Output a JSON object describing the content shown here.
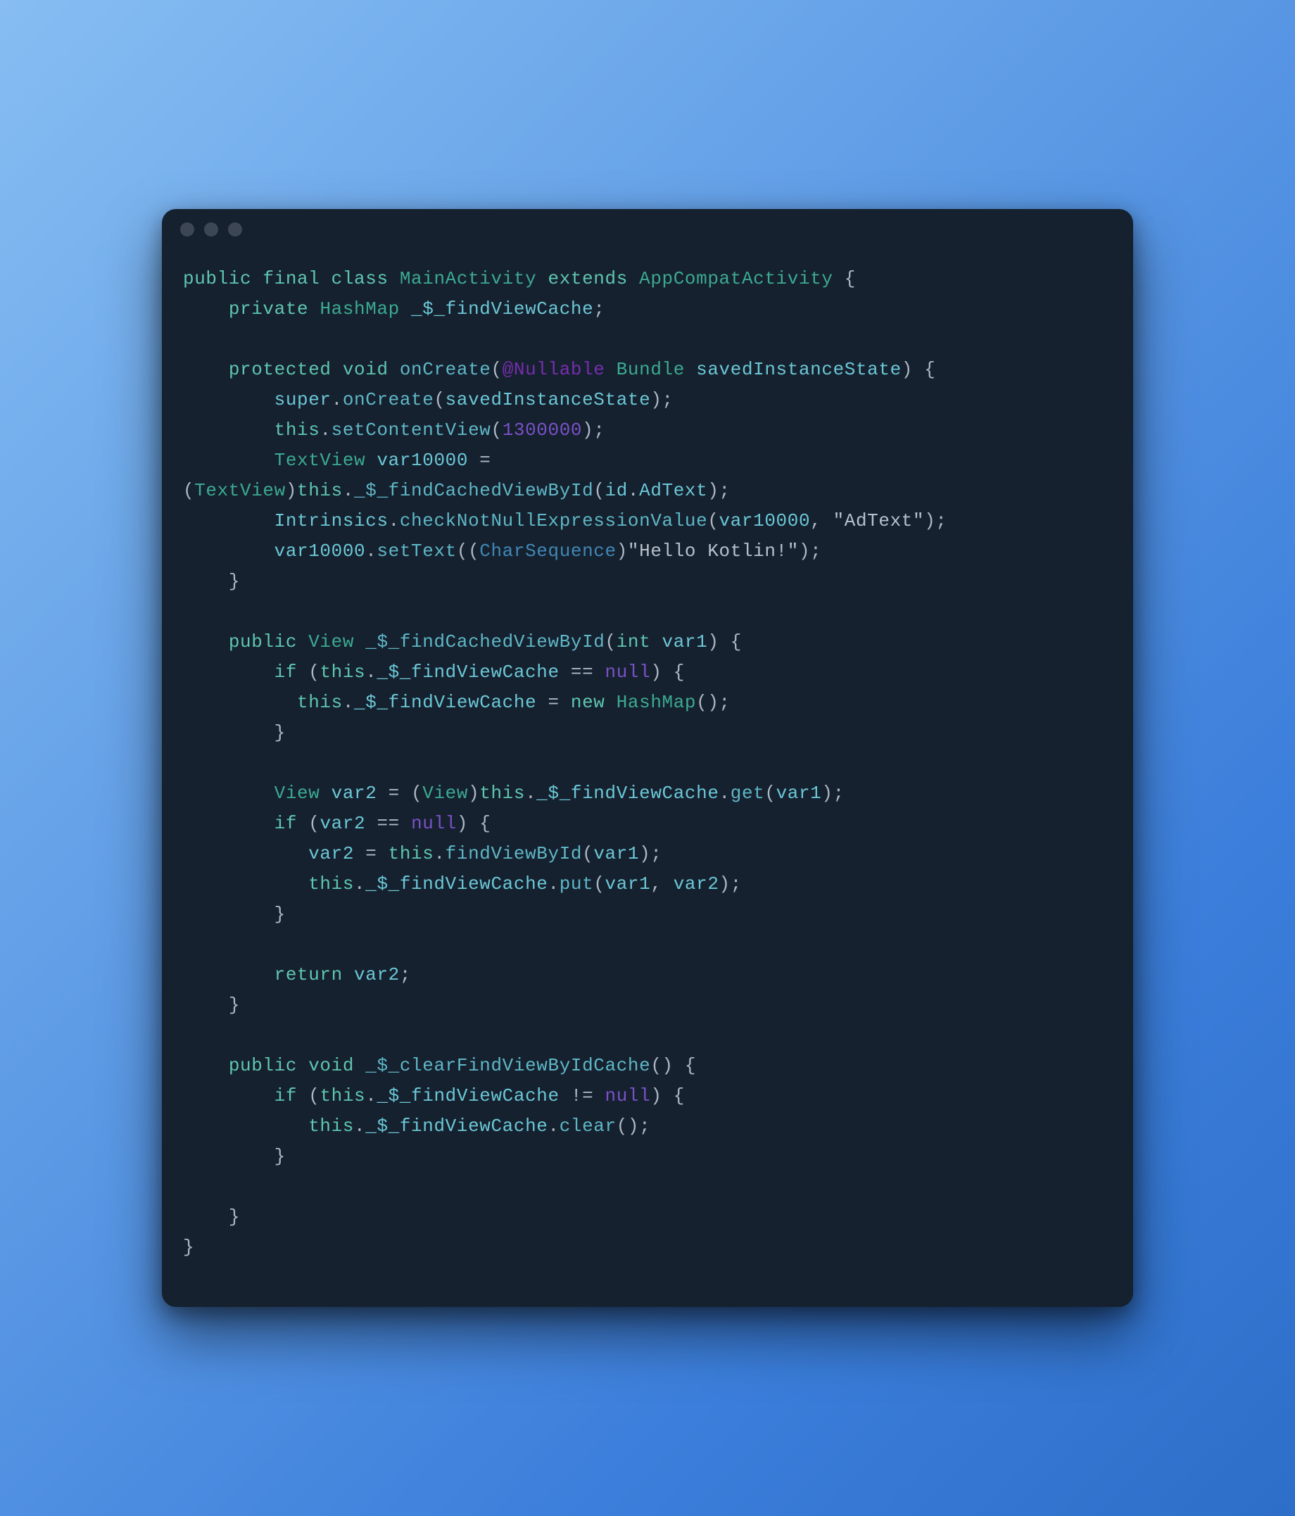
{
  "code": {
    "l1": {
      "kw1": "public",
      "kw2": "final",
      "kw3": "class",
      "typ1": "MainActivity",
      "kw4": "extends",
      "typ2": "AppCompatActivity",
      "ob": "{"
    },
    "l2": {
      "kw1": "private",
      "typ": "HashMap",
      "id": "_$_findViewCache",
      "sc": ";"
    },
    "l3": {
      "kw1": "protected",
      "kw2": "void",
      "m": "onCreate",
      "lp": "(",
      "annot": "@Nullable",
      "typ": "Bundle",
      "id": "savedInstanceState",
      "rp": ")",
      "ob": " {"
    },
    "l4": {
      "id1": "super",
      "dot": ".",
      "m": "onCreate",
      "lp": "(",
      "id2": "savedInstanceState",
      "rp": ")",
      "sc": ";"
    },
    "l5": {
      "kw": "this",
      "dot": ".",
      "m": "setContentView",
      "lp": "(",
      "num": "1300000",
      "rp": ")",
      "sc": ";"
    },
    "l6": {
      "typ": "TextView",
      "id": "var10000",
      "eq": " ="
    },
    "l7": {
      "lp": "(",
      "typ": "TextView",
      "rp": ")",
      "kw": "this",
      "dot": ".",
      "m": "_$_findCachedViewById",
      "lp2": "(",
      "id2": "id",
      "dot2": ".",
      "id3": "AdText",
      "rp2": ")",
      "sc": ";"
    },
    "l8": {
      "id1": "Intrinsics",
      "dot": ".",
      "m": "checkNotNullExpressionValue",
      "lp": "(",
      "id2": "var10000",
      "cm": ", ",
      "str": "\"AdText\"",
      "rp": ")",
      "sc": ";"
    },
    "l9": {
      "id1": "var10000",
      "dot": ".",
      "m": "setText",
      "lp": "(",
      "lp2": "(",
      "typ": "CharSequence",
      "rp2": ")",
      "str": "\"Hello Kotlin!\"",
      "rp": ")",
      "sc": ";"
    },
    "l10": {
      "cb": "}"
    },
    "l12": {
      "kw1": "public",
      "typ": "View",
      "m": "_$_findCachedViewById",
      "lp": "(",
      "kw2": "int",
      "id": "var1",
      "rp": ")",
      "ob": " {"
    },
    "l13": {
      "kw": "if",
      "lp": " (",
      "kw2": "this",
      "dot": ".",
      "id": "_$_findViewCache",
      "eq": " == ",
      "nul": "null",
      "rp": ")",
      "ob": " {"
    },
    "l14": {
      "kw": "this",
      "dot": ".",
      "id": "_$_findViewCache",
      "eq": " = ",
      "kw2": "new",
      "typ": "HashMap",
      "lp": "(",
      "rp": ")",
      "sc": ";"
    },
    "l15": {
      "cb": "}"
    },
    "l17": {
      "typ": "View",
      "id": "var2",
      "eq": " = ",
      "lp": "(",
      "typ2": "View",
      "rp": ")",
      "kw": "this",
      "dot": ".",
      "id2": "_$_findViewCache",
      "dot2": ".",
      "m": "get",
      "lp2": "(",
      "id3": "var1",
      "rp2": ")",
      "sc": ";"
    },
    "l18": {
      "kw": "if",
      "lp": " (",
      "id": "var2",
      "eq": " == ",
      "nul": "null",
      "rp": ")",
      "ob": " {"
    },
    "l19": {
      "id": "var2",
      "eq": " = ",
      "kw": "this",
      "dot": ".",
      "m": "findViewById",
      "lp": "(",
      "id2": "var1",
      "rp": ")",
      "sc": ";"
    },
    "l20": {
      "kw": "this",
      "dot": ".",
      "id": "_$_findViewCache",
      "dot2": ".",
      "m": "put",
      "lp": "(",
      "id2": "var1",
      "cm": ", ",
      "id3": "var2",
      "rp": ")",
      "sc": ";"
    },
    "l21": {
      "cb": "}"
    },
    "l23": {
      "kw": "return",
      "id": "var2",
      "sc": ";"
    },
    "l24": {
      "cb": "}"
    },
    "l26": {
      "kw1": "public",
      "kw2": "void",
      "m": "_$_clearFindViewByIdCache",
      "lp": "(",
      "rp": ")",
      "ob": " {"
    },
    "l27": {
      "kw": "if",
      "lp": " (",
      "kw2": "this",
      "dot": ".",
      "id": "_$_findViewCache",
      "neq": " != ",
      "nul": "null",
      "rp": ")",
      "ob": " {"
    },
    "l28": {
      "kw": "this",
      "dot": ".",
      "id": "_$_findViewCache",
      "dot2": ".",
      "m": "clear",
      "lp": "(",
      "rp": ")",
      "sc": ";"
    },
    "l29": {
      "cb": "}"
    },
    "l31": {
      "cb": "}"
    },
    "l32": {
      "cb": "}"
    }
  }
}
